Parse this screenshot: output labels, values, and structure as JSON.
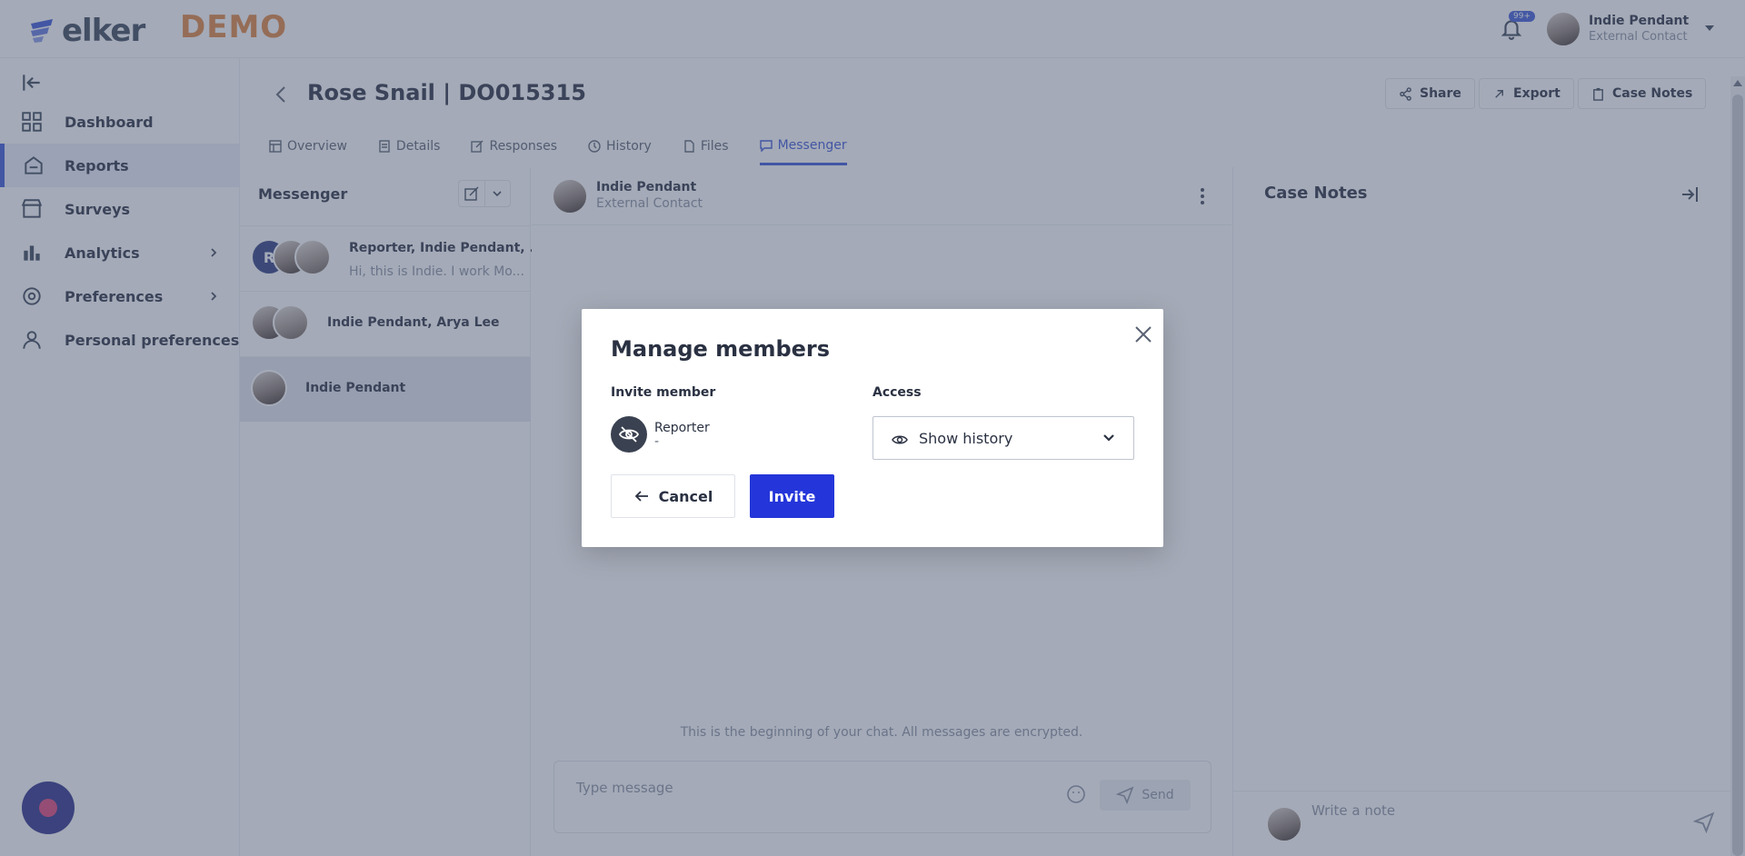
{
  "header": {
    "logo_text": "elker",
    "demo_label": "DEMO",
    "notification_badge": "99+",
    "user_name": "Indie Pendant",
    "user_role": "External Contact"
  },
  "sidebar": {
    "items": [
      {
        "label": "Dashboard",
        "icon": "dashboard-icon"
      },
      {
        "label": "Reports",
        "icon": "reports-icon",
        "active": true
      },
      {
        "label": "Surveys",
        "icon": "surveys-icon"
      },
      {
        "label": "Analytics",
        "icon": "analytics-icon",
        "has_submenu": true
      },
      {
        "label": "Preferences",
        "icon": "gear-icon",
        "has_submenu": true
      },
      {
        "label": "Personal preferences",
        "icon": "user-icon"
      }
    ]
  },
  "page": {
    "title": "Rose Snail | DO015315",
    "actions": {
      "share": "Share",
      "export": "Export",
      "case_notes": "Case Notes"
    },
    "tabs": [
      {
        "label": "Overview"
      },
      {
        "label": "Details"
      },
      {
        "label": "Responses"
      },
      {
        "label": "History"
      },
      {
        "label": "Files"
      },
      {
        "label": "Messenger",
        "active": true
      }
    ]
  },
  "messenger": {
    "title": "Messenger",
    "conversations": [
      {
        "name": "Reporter, Indie Pendant, ...",
        "snippet": "Hi, this is Indie. I work Mo...",
        "avatar_initial": "R"
      },
      {
        "name": "Indie Pendant, Arya Lee"
      },
      {
        "name": "Indie Pendant",
        "selected": true
      }
    ]
  },
  "chat": {
    "contact_name": "Indie Pendant",
    "contact_role": "External Contact",
    "encrypted_notice": "This is the beginning of your chat. All messages are encrypted.",
    "input_placeholder": "Type message",
    "send_label": "Send"
  },
  "case_notes": {
    "title": "Case Notes",
    "note_placeholder": "Write a note"
  },
  "modal": {
    "title": "Manage members",
    "invite_label": "Invite member",
    "access_label": "Access",
    "member_name": "Reporter",
    "member_sub": "-",
    "access_value": "Show history",
    "cancel_label": "Cancel",
    "invite_button": "Invite"
  },
  "colors": {
    "accent": "#3b56d8",
    "invite_button": "#2436d9",
    "demo": "#e0843f",
    "overlay": "#4a5670"
  }
}
